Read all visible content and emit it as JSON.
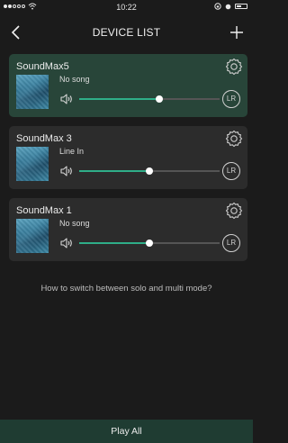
{
  "status_bar": {
    "time": "10:22"
  },
  "nav": {
    "title": "DEVICE LIST",
    "back_icon": "chevron-left-icon",
    "add_icon": "plus-icon"
  },
  "devices": [
    {
      "name": "SoundMax5",
      "song": "No song",
      "volume": 0.57,
      "mode": "LR",
      "selected": true
    },
    {
      "name": "SoundMax 3",
      "song": "Line In",
      "volume": 0.5,
      "mode": "LR",
      "selected": false
    },
    {
      "name": "SoundMax 1",
      "song": "No song",
      "volume": 0.5,
      "mode": "LR",
      "selected": false
    }
  ],
  "help_text": "How to switch between solo and multi mode?",
  "bottom_bar": {
    "label": "Play All"
  },
  "colors": {
    "accent": "#2fae88",
    "selected_card": "#284539",
    "card": "#2c2c2c",
    "background": "#1b1b1b",
    "bottom_bar": "#1f3c32"
  }
}
